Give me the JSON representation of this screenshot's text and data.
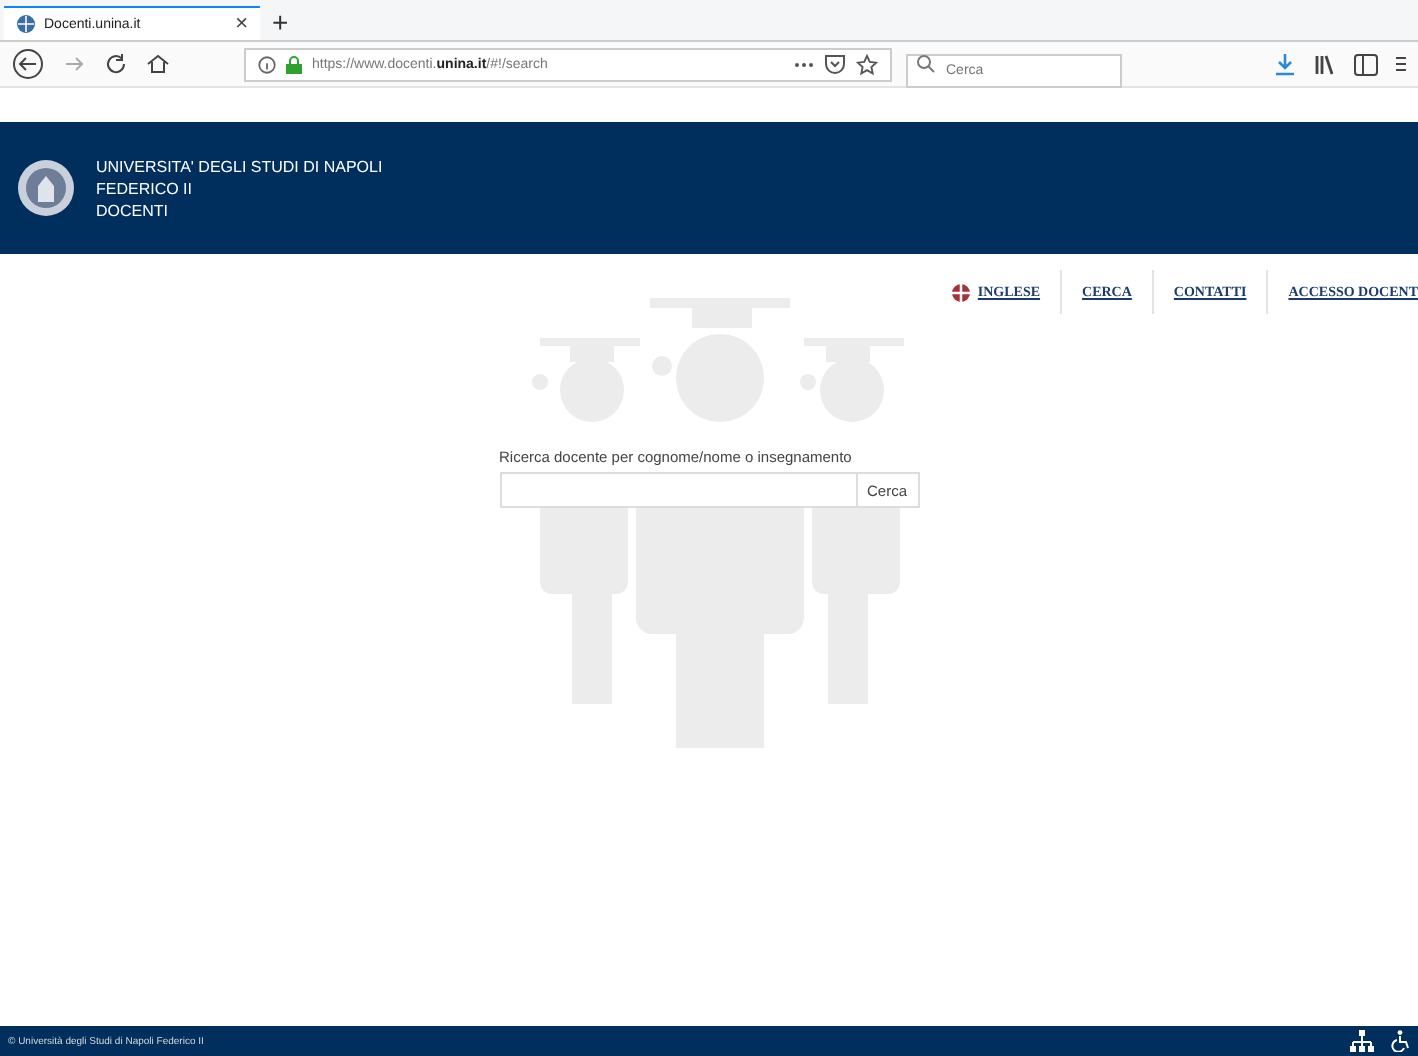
{
  "browser": {
    "tabs": [
      {
        "title": "Docenti.unina.it",
        "close": "×",
        "selected": true
      }
    ],
    "new_tab": "+",
    "url": "https://www.docenti.**unina.it**/#!/search",
    "search": {
      "placeholder": "Cerca"
    }
  },
  "header": {
    "lines": [
      "UNIVERSITA' DEGLI STUDI DI NAPOLI",
      "FEDERICO II",
      "DOCENTI"
    ]
  },
  "nav": [
    {
      "label": "INGLESE",
      "kind": "language"
    },
    {
      "label": "CERCA",
      "kind": "link"
    },
    {
      "label": "CONTATTI",
      "kind": "link"
    },
    {
      "label": "ACCESSO DOCENT",
      "kind": "link"
    }
  ],
  "search": {
    "label": "Ricerca docente per cognome/nome o insegnamento",
    "button": "Cerca"
  },
  "footer": {
    "text": "© Università degli Studi di Napoli Federico II"
  }
}
